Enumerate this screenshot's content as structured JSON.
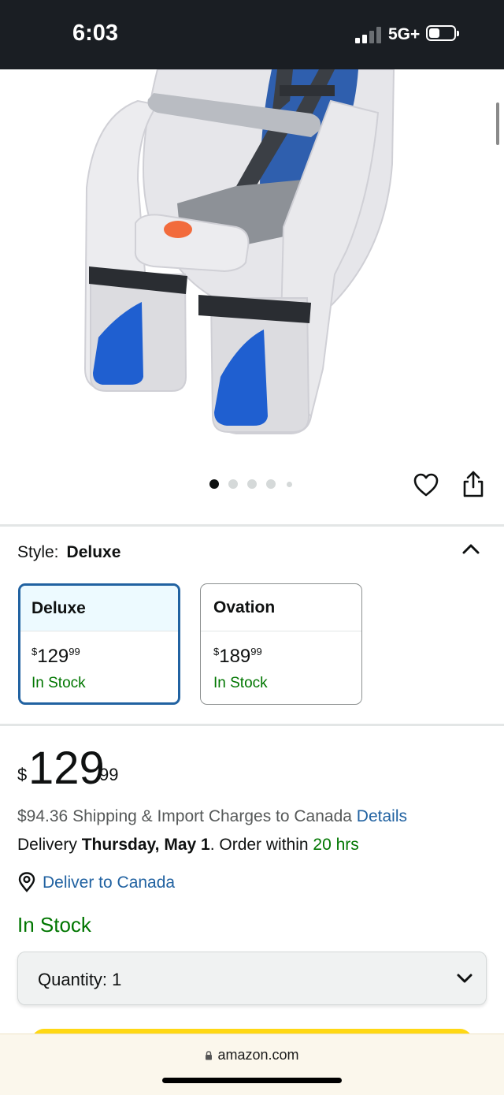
{
  "status_bar": {
    "time": "6:03",
    "network": "5G+"
  },
  "product": {
    "image_icon": "child-bike-seat-image",
    "image_count": 5,
    "selected_image": 1
  },
  "style": {
    "label": "Style:",
    "selected": "Deluxe",
    "options": [
      {
        "name": "Deluxe",
        "price_symbol": "$",
        "price_whole": "129",
        "price_fraction": "99",
        "stock": "In Stock"
      },
      {
        "name": "Ovation",
        "price_symbol": "$",
        "price_whole": "189",
        "price_fraction": "99",
        "stock": "In Stock"
      }
    ]
  },
  "price": {
    "symbol": "$",
    "whole": "129",
    "fraction": "99"
  },
  "shipping": {
    "text": "$94.36 Shipping & Import Charges to Canada",
    "link": "Details"
  },
  "delivery": {
    "prefix": "Delivery",
    "date": "Thursday, May 1",
    "middle": ". Order within",
    "countdown": "20 hrs"
  },
  "deliver_to": "Deliver to Canada",
  "availability": "In Stock",
  "quantity": {
    "label": "Quantity:",
    "value": "1"
  },
  "browser": {
    "url": "amazon.com"
  },
  "colors": {
    "link": "#2162a1",
    "in_stock": "#007600",
    "selected_border": "#2162a1",
    "add_to_cart": "#ffd814"
  }
}
